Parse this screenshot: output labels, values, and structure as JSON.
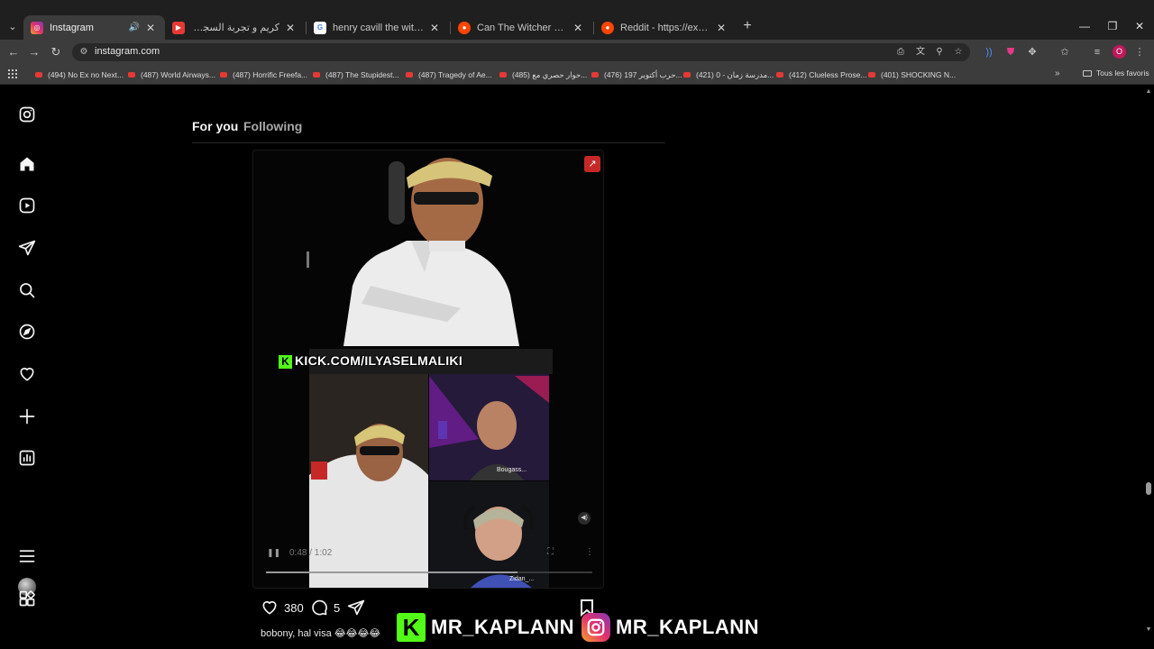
{
  "browser": {
    "tabs": [
      {
        "title": "Instagram",
        "active": true,
        "icon": "instagram-icon",
        "audio": true
      },
      {
        "title": "كريم و تجربة السجن في أمريكا - ...",
        "icon": "youtube-icon"
      },
      {
        "title": "henry cavill the witcher - Googl...",
        "icon": "google-icon"
      },
      {
        "title": "Can The Witcher Survive Witho...",
        "icon": "reddit-icon"
      },
      {
        "title": "Reddit - https://external-previe...",
        "icon": "reddit-icon"
      }
    ],
    "url": "instagram.com",
    "profile_initial": "O",
    "bookmarks": [
      "(494) No Ex no Next...",
      "(487) World Airways...",
      "(487) Horrific Freefa...",
      "(487) The Stupidest...",
      "(487) Tragedy of Ae...",
      "(485) حوار حصري مع...",
      "(476) حرب أكتوبر 197...",
      "(421) مدرسة زمان - 0...",
      "(412) Clueless Prose...",
      "(401) SHOCKING N..."
    ],
    "bookmarks_folder": "Tous les favoris"
  },
  "sidebar": {
    "items": [
      {
        "name": "instagram-logo-icon"
      },
      {
        "name": "home-icon"
      },
      {
        "name": "reels-icon"
      },
      {
        "name": "messages-icon"
      },
      {
        "name": "search-icon"
      },
      {
        "name": "explore-icon"
      },
      {
        "name": "notifications-icon"
      },
      {
        "name": "create-icon"
      },
      {
        "name": "dashboard-icon"
      },
      {
        "name": "profile-avatar"
      },
      {
        "name": "more-menu-icon"
      },
      {
        "name": "also-from-meta-icon"
      }
    ]
  },
  "feed": {
    "tab_for_you": "For you",
    "tab_following": "Following"
  },
  "reel": {
    "banner_text": "KICK.COM/ILYASELMALIKI",
    "cam_label_1": "Bougass...",
    "cam_label_2": "Zidan_...",
    "time": "0:48 / 1:02",
    "progress": 0.77
  },
  "post": {
    "likes": "380",
    "comments": "5",
    "caption": "bobony, hal visa 😂😂😂😂"
  },
  "overlay": {
    "kick_handle": "MR_KAPLANN",
    "instagram_handle": "MR_KAPLANN"
  },
  "colors": {
    "kick_green": "#53fc18",
    "accent_red": "#c62828"
  }
}
